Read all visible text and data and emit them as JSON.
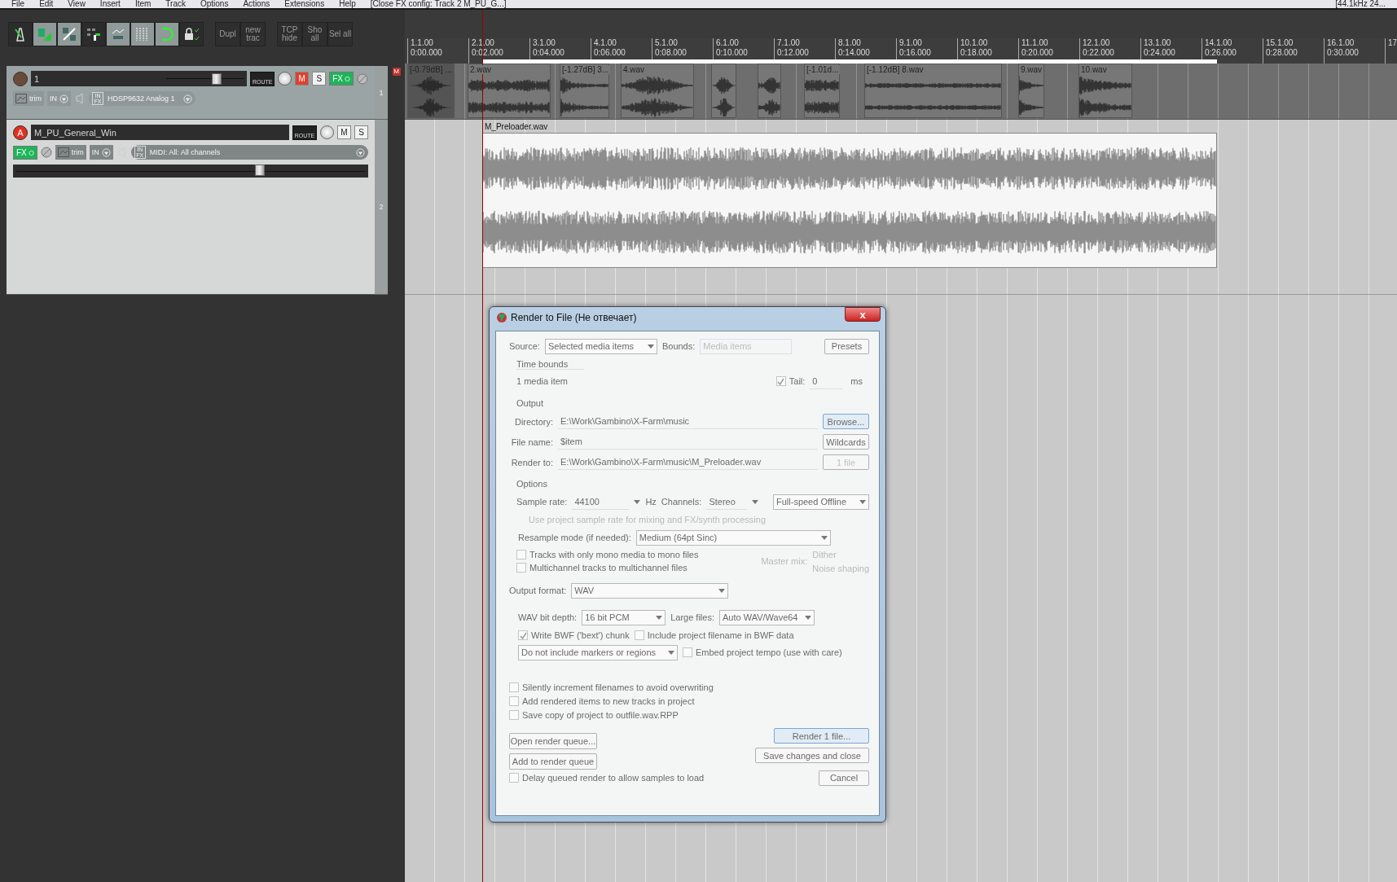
{
  "menu": {
    "items": [
      "File",
      "Edit",
      "View",
      "Insert",
      "Item",
      "Track",
      "Options",
      "Actions",
      "Extensions",
      "Help"
    ],
    "status": "[Close FX config: Track 2 M_PU_G...]",
    "right": "[44.1kHz 24..."
  },
  "toolbar": {
    "icons": [
      {
        "kind": "metronome",
        "on": false
      },
      {
        "kind": "ripple",
        "on": true
      },
      {
        "kind": "grouping",
        "on": true
      },
      {
        "kind": "snap",
        "on": false
      },
      {
        "kind": "envelope",
        "on": true
      },
      {
        "kind": "grid",
        "on": true
      },
      {
        "kind": "loop",
        "on": true
      },
      {
        "kind": "lock",
        "on": false
      }
    ],
    "groups": [
      [
        "Dupl",
        "new trac"
      ],
      [
        "TCP hide",
        "Sho all",
        "Sel all"
      ]
    ]
  },
  "tracks": [
    {
      "number": "1",
      "name": "1",
      "selected": false,
      "armed": false,
      "muted": true,
      "soloed": false,
      "fx_on": true,
      "fx": "FX",
      "route": "ROUTE",
      "mute": "M",
      "solo": "S",
      "trim": "trim",
      "in": "IN",
      "in_fx": "IN FX",
      "input": "HDSP9632 Analog 1",
      "level": 0.67
    },
    {
      "number": "2",
      "name": "M_PU_General_Win",
      "selected": true,
      "armed": true,
      "arm_label": "A",
      "muted": false,
      "soloed": false,
      "fx_on": true,
      "fx": "FX",
      "route": "ROUTE",
      "mute": "M",
      "solo": "S",
      "trim": "trim",
      "in": "IN",
      "in_fx": "IN FX",
      "input": "MIDI: All: All channels",
      "level": 0.7
    }
  ],
  "lane_badge": "M",
  "ruler": [
    {
      "bar": "1.1.00",
      "time": "0:00.000"
    },
    {
      "bar": "2.1.00",
      "time": "0:02.000"
    },
    {
      "bar": "3.1.00",
      "time": "0:04.000"
    },
    {
      "bar": "4.1.00",
      "time": "0:06.000"
    },
    {
      "bar": "5.1.00",
      "time": "0:08.000"
    },
    {
      "bar": "6.1.00",
      "time": "0:10.000"
    },
    {
      "bar": "7.1.00",
      "time": "0:12.000"
    },
    {
      "bar": "8.1.00",
      "time": "0:14.000"
    },
    {
      "bar": "9.1.00",
      "time": "0:16.000"
    },
    {
      "bar": "10.1.00",
      "time": "0:18.000"
    },
    {
      "bar": "11.1.00",
      "time": "0:20.000"
    },
    {
      "bar": "12.1.00",
      "time": "0:22.000"
    },
    {
      "bar": "13.1.00",
      "time": "0:24.000"
    },
    {
      "bar": "14.1.00",
      "time": "0:26.000"
    },
    {
      "bar": "15.1.00",
      "time": "0:28.000"
    },
    {
      "bar": "16.1.00",
      "time": "0:30.000"
    },
    {
      "bar": "17"
    }
  ],
  "track1_items": [
    {
      "label": "[-0.79dB] ...",
      "selected": true
    },
    {
      "label": "2.wav",
      "selected": false
    },
    {
      "label": "[-1.27dB] 3...",
      "selected": false
    },
    {
      "label": "4.wav",
      "selected": false
    },
    {
      "selected": false
    },
    {
      "selected": false
    },
    {
      "label": "[-1.01d...",
      "selected": false
    },
    {
      "label": "[-1.12dB] 8.wav",
      "selected": false
    },
    {
      "label": "9.wav",
      "selected": false
    },
    {
      "label": "10.wav",
      "selected": false
    }
  ],
  "track2_item": {
    "label": "M_Preloader.wav"
  },
  "dialog": {
    "title": "Render to File (Не отвечает)",
    "close": "x",
    "source": {
      "label": "Source:",
      "value": "Selected media items"
    },
    "bounds": {
      "label": "Bounds:",
      "value": "Media items"
    },
    "presets": "Presets",
    "time_bounds": "Time bounds",
    "time_bounds_value": "1 media item",
    "tail": {
      "label": "Tail:",
      "checked": true,
      "value": "0",
      "unit": "ms"
    },
    "output": "Output",
    "directory": {
      "label": "Directory:",
      "value": "E:\\Work\\Gambino\\X-Farm\\music"
    },
    "browse": "Browse...",
    "file_name": {
      "label": "File name:",
      "value": "$item"
    },
    "wildcards": "Wildcards",
    "render_to": {
      "label": "Render to:",
      "value": "E:\\Work\\Gambino\\X-Farm\\music\\M_Preloader.wav"
    },
    "file_count": "1 file",
    "options": "Options",
    "sample_rate": {
      "label": "Sample rate:",
      "value": "44100",
      "unit": "Hz"
    },
    "channels": {
      "label": "Channels:",
      "value": "Stereo"
    },
    "speed": "Full-speed Offline",
    "hint": "Use project sample rate for mixing and FX/synth processing",
    "resample": {
      "label": "Resample mode (if needed):",
      "value": "Medium (64pt Sinc)"
    },
    "mono": {
      "label": "Tracks with only mono media to mono files",
      "checked": false
    },
    "multichannel": {
      "label": "Multichannel tracks to multichannel files",
      "checked": false
    },
    "master_mix": "Master mix:",
    "dither": "Dither",
    "noise_shaping": "Noise shaping",
    "format": {
      "label": "Output format:",
      "value": "WAV"
    },
    "bit_depth": {
      "label": "WAV bit depth:",
      "value": "16 bit PCM"
    },
    "large_files": {
      "label": "Large files:",
      "value": "Auto WAV/Wave64"
    },
    "bwf": {
      "label": "Write BWF ('bext') chunk",
      "checked": true
    },
    "bwf_filename": {
      "label": "Include project filename in BWF data",
      "checked": false
    },
    "markers": "Do not include markers or regions",
    "tempo": {
      "label": "Embed project tempo (use with care)",
      "checked": false
    },
    "checks": [
      {
        "label": "Silently increment filenames to avoid overwriting",
        "checked": false
      },
      {
        "label": "Add rendered items to new tracks in project",
        "checked": false
      },
      {
        "label": "Save copy of project to outfile.wav.RPP",
        "checked": false
      }
    ],
    "open_queue": "Open render queue...",
    "add_queue": "Add to render queue",
    "render": "Render 1 file...",
    "save_close": "Save changes and close",
    "cancel": "Cancel",
    "delay": {
      "label": "Delay queued render to allow samples to load",
      "checked": false
    }
  }
}
